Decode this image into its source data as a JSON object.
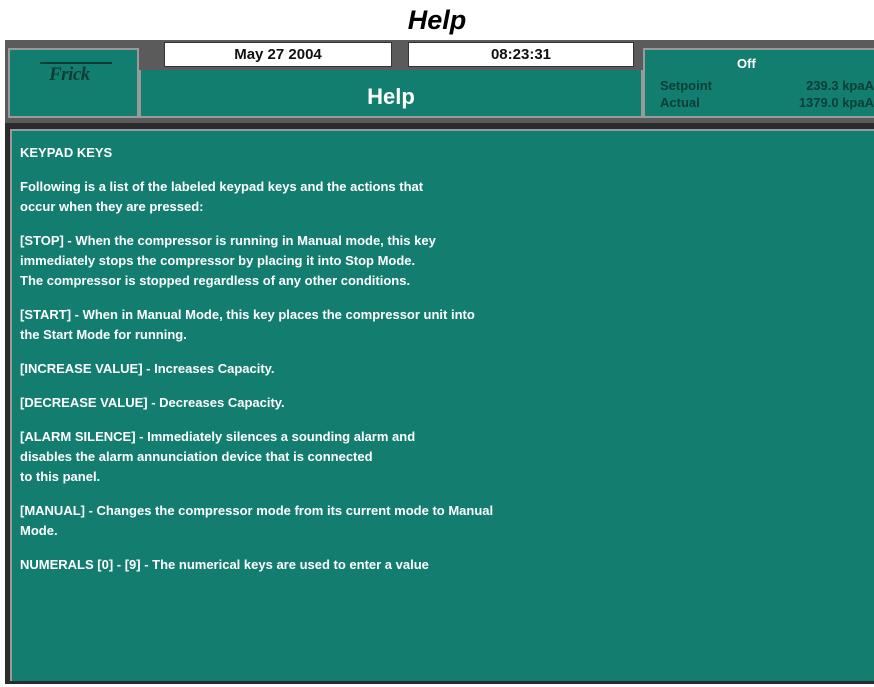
{
  "page_heading": "Help",
  "header": {
    "logo": "Frick",
    "date": "May 27 2004",
    "time": "08:23:31",
    "screen_title": "Help",
    "status": "Off",
    "setpoint_label": "Setpoint",
    "setpoint_value": "239.3 kpaA",
    "actual_label": "Actual",
    "actual_value": "1379.0 kpaA"
  },
  "help": {
    "heading": "KEYPAD KEYS",
    "paragraphs": [
      "Following is a list of the labeled keypad keys and the actions that\noccur when they are pressed:",
      "[STOP] - When the compressor is running in Manual mode, this key\nimmediately stops the compressor by placing it into Stop Mode.\nThe compressor is stopped regardless of any other conditions.",
      "[START] - When in Manual Mode, this key places the compressor unit into\nthe Start Mode for running.",
      "[INCREASE VALUE] - Increases Capacity.",
      "[DECREASE VALUE] - Decreases Capacity.",
      "[ALARM SILENCE] - Immediately silences a sounding alarm and\ndisables the alarm annunciation device that is connected\nto this panel.",
      "[MANUAL] - Changes the compressor mode from its current mode to Manual\nMode.",
      "NUMERALS [0] - [9] - The numerical keys are used to enter a value"
    ]
  },
  "colors": {
    "panel_teal": "#137e70",
    "frame_gray": "#5b5b5b",
    "text": "#ffffff"
  }
}
